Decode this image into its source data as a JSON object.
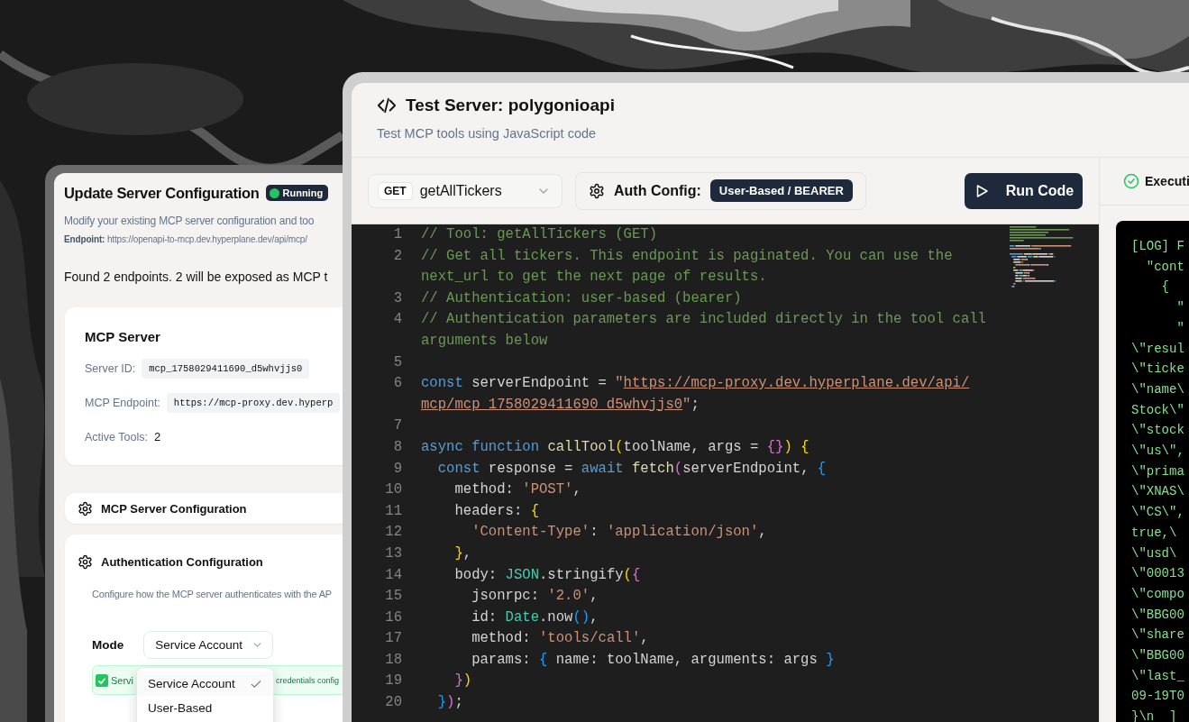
{
  "config_dialog": {
    "title": "Update Server Configuration",
    "status_badge": "Running",
    "subtitle": "Modify your existing MCP server configuration and too",
    "endpoint": "**Endpoint:** https://openapi-to-mcp.dev.hyperplane.dev/api/mcp/",
    "summary": "Found 2 endpoints. 2 will be exposed as MCP t",
    "server_card": {
      "title": "MCP Server",
      "fields": [
        {
          "label": "Server ID:",
          "value": "mcp_1758029411690_d5whvjjs0",
          "kind": "code"
        },
        {
          "label": "MCP Endpoint:",
          "value": "https://mcp-proxy.dev.hyperp",
          "kind": "code"
        },
        {
          "label": "Active Tools:",
          "value": "2",
          "kind": "plain"
        }
      ]
    },
    "config_section": {
      "title": "MCP Server Configuration"
    },
    "auth_section": {
      "title": "Authentication Configuration",
      "description": "Configure how the MCP server authenticates with the AP",
      "mode_label": "Mode",
      "mode_value": "Service Account",
      "status": [
        "Servi",
        "credentials config"
      ],
      "menu": [
        {
          "label": "Service Account",
          "selected": true
        },
        {
          "label": "User-Based",
          "selected": false
        }
      ]
    }
  },
  "test_window": {
    "title": "Test Server: polygonioapi",
    "subtitle": "Test MCP tools using JavaScript code",
    "tool_select": {
      "method": "GET",
      "value": "getAllTickers"
    },
    "auth_config": {
      "label": "Auth Config:",
      "value": "User-Based / BEARER"
    },
    "run_button": "Run Code",
    "code": [
      {
        "number": "1",
        "wrapped_lines": [
          {
            "tokens": [
              {
                "kind": "comment",
                "text": "// Tool: getAllTickers (GET)"
              }
            ]
          }
        ]
      },
      {
        "number": "2",
        "wrapped_lines": [
          {
            "tokens": [
              {
                "kind": "comment",
                "text": "// Get all tickers. This endpoint is paginated. You can use the"
              }
            ]
          },
          {
            "tokens": [
              {
                "kind": "comment",
                "text": "next_url to get the next page of results."
              }
            ]
          }
        ]
      },
      {
        "number": "3",
        "wrapped_lines": [
          {
            "tokens": [
              {
                "kind": "comment",
                "text": "// Authentication: user-based (bearer)"
              }
            ]
          }
        ]
      },
      {
        "number": "4",
        "wrapped_lines": [
          {
            "tokens": [
              {
                "kind": "comment",
                "text": "// Authentication parameters are included directly in the tool call"
              }
            ]
          },
          {
            "tokens": [
              {
                "kind": "comment",
                "text": "arguments below"
              }
            ]
          }
        ]
      },
      {
        "number": "5"
      },
      {
        "number": "6",
        "wrapped_lines": [
          {
            "tokens": [
              {
                "kind": "keyword",
                "text": "const"
              },
              {
                "kind": "plain",
                "text": " serverEndpoint = "
              },
              {
                "kind": "string",
                "text": "\""
              },
              {
                "kind": "link",
                "text": "https://mcp-proxy.dev.hyperplane.dev/api/"
              }
            ]
          },
          {
            "tokens": [
              {
                "kind": "link",
                "text": "mcp/mcp_1758029411690_d5whvjjs0"
              },
              {
                "kind": "string",
                "text": "\""
              },
              {
                "kind": "plain",
                "text": ";"
              }
            ]
          }
        ]
      },
      {
        "number": "7"
      },
      {
        "number": "8",
        "wrapped_lines": [
          {
            "tokens": [
              {
                "kind": "keyword",
                "text": "async function "
              },
              {
                "kind": "func",
                "text": "callTool"
              },
              {
                "kind": "bracket1",
                "text": "("
              },
              {
                "kind": "plain",
                "text": "toolName, args = "
              },
              {
                "kind": "bracket2",
                "text": "{}"
              },
              {
                "kind": "bracket1",
                "text": ") {"
              }
            ]
          }
        ]
      },
      {
        "number": "9",
        "wrapped_lines": [
          {
            "tokens": [
              {
                "kind": "keyword",
                "text": "  const"
              },
              {
                "kind": "plain",
                "text": " response = "
              },
              {
                "kind": "keyword",
                "text": "await "
              },
              {
                "kind": "func",
                "text": "fetch"
              },
              {
                "kind": "bracket2",
                "text": "("
              },
              {
                "kind": "plain",
                "text": "serverEndpoint, "
              },
              {
                "kind": "bracket3",
                "text": "{"
              }
            ]
          }
        ]
      },
      {
        "number": "10",
        "wrapped_lines": [
          {
            "tokens": [
              {
                "kind": "plain",
                "text": "    method: "
              },
              {
                "kind": "string",
                "text": "'POST'"
              },
              {
                "kind": "plain",
                "text": ","
              }
            ]
          }
        ]
      },
      {
        "number": "11",
        "wrapped_lines": [
          {
            "tokens": [
              {
                "kind": "plain",
                "text": "    headers: "
              },
              {
                "kind": "bracket1",
                "text": "{"
              }
            ]
          }
        ]
      },
      {
        "number": "12",
        "wrapped_lines": [
          {
            "tokens": [
              {
                "kind": "string",
                "text": "      'Content-Type'"
              },
              {
                "kind": "plain",
                "text": ": "
              },
              {
                "kind": "string",
                "text": "'application/json'"
              },
              {
                "kind": "plain",
                "text": ","
              }
            ]
          }
        ]
      },
      {
        "number": "13",
        "wrapped_lines": [
          {
            "tokens": [
              {
                "kind": "bracket1",
                "text": "    }"
              },
              {
                "kind": "plain",
                "text": ","
              }
            ]
          }
        ]
      },
      {
        "number": "14",
        "wrapped_lines": [
          {
            "tokens": [
              {
                "kind": "plain",
                "text": "    body: "
              },
              {
                "kind": "type",
                "text": "JSON"
              },
              {
                "kind": "plain",
                "text": ".stringify"
              },
              {
                "kind": "bracket1",
                "text": "("
              },
              {
                "kind": "bracket2",
                "text": "{"
              }
            ]
          }
        ]
      },
      {
        "number": "15",
        "wrapped_lines": [
          {
            "tokens": [
              {
                "kind": "plain",
                "text": "      jsonrpc: "
              },
              {
                "kind": "string",
                "text": "'2.0'"
              },
              {
                "kind": "plain",
                "text": ","
              }
            ]
          }
        ]
      },
      {
        "number": "16",
        "wrapped_lines": [
          {
            "tokens": [
              {
                "kind": "plain",
                "text": "      id: "
              },
              {
                "kind": "type",
                "text": "Date"
              },
              {
                "kind": "plain",
                "text": ".now"
              },
              {
                "kind": "bracket3",
                "text": "()"
              },
              {
                "kind": "plain",
                "text": ","
              }
            ]
          }
        ]
      },
      {
        "number": "17",
        "wrapped_lines": [
          {
            "tokens": [
              {
                "kind": "plain",
                "text": "      method: "
              },
              {
                "kind": "string",
                "text": "'tools/call'"
              },
              {
                "kind": "plain",
                "text": ","
              }
            ]
          }
        ]
      },
      {
        "number": "18",
        "wrapped_lines": [
          {
            "tokens": [
              {
                "kind": "plain",
                "text": "      params: "
              },
              {
                "kind": "bracket3",
                "text": "{"
              },
              {
                "kind": "plain",
                "text": " name: toolName, arguments: args "
              },
              {
                "kind": "bracket3",
                "text": "}"
              }
            ]
          }
        ]
      },
      {
        "number": "19",
        "wrapped_lines": [
          {
            "tokens": [
              {
                "kind": "bracket2",
                "text": "    }"
              },
              {
                "kind": "bracket1",
                "text": ")"
              }
            ]
          }
        ]
      },
      {
        "number": "20",
        "wrapped_lines": [
          {
            "tokens": [
              {
                "kind": "bracket3",
                "text": "  }"
              },
              {
                "kind": "bracket2",
                "text": ")"
              },
              {
                "kind": "plain",
                "text": ";"
              }
            ]
          }
        ]
      }
    ],
    "output": {
      "title": "Executi",
      "lines": [
        "[LOG] F",
        "  \"cont",
        "    {",
        "      \"",
        "      \"",
        "\\\"resul",
        "\\\"ticke",
        "\\\"name\\",
        "Stock\\\"",
        "\\\"stock",
        "\\\"us\\\",",
        "\\\"prima",
        "\\\"XNAS\\",
        "\\\"CS\\\",",
        "true,\\",
        "\\\"usd\\",
        "\\\"00013",
        "\\\"compo",
        "\\\"BBG00",
        "\\\"share",
        "\\\"BBG00",
        "\\\"last_",
        "09-19T0",
        "}\\n  ]"
      ]
    }
  }
}
